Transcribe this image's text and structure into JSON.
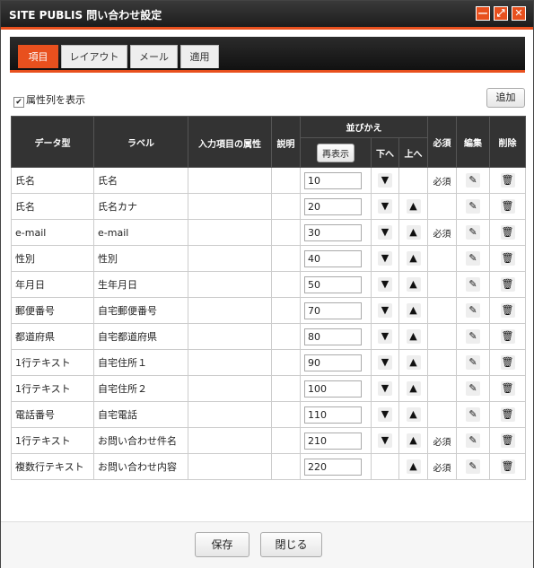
{
  "window": {
    "title": "SITE PUBLIS 問い合わせ設定",
    "minimize": "—",
    "maximize": "⤢",
    "close": "✕"
  },
  "tabs": [
    {
      "label": "項目",
      "active": true
    },
    {
      "label": "レイアウト",
      "active": false
    },
    {
      "label": "メール",
      "active": false
    },
    {
      "label": "適用",
      "active": false
    }
  ],
  "toolbar": {
    "show_attr_label": "属性列を表示",
    "show_attr_checked": true,
    "add_label": "追加"
  },
  "table": {
    "headers": {
      "type": "データ型",
      "label": "ラベル",
      "attr": "入力項目の属性",
      "desc": "説明",
      "sort": "並びかえ",
      "refresh": "再表示",
      "down": "下へ",
      "up": "上へ",
      "required": "必須",
      "edit": "編集",
      "delete": "削除"
    },
    "rows": [
      {
        "type": "氏名",
        "label": "氏名",
        "order": "10",
        "down": true,
        "up": false,
        "required": "必須"
      },
      {
        "type": "氏名",
        "label": "氏名カナ",
        "order": "20",
        "down": true,
        "up": true,
        "required": ""
      },
      {
        "type": "e-mail",
        "label": "e-mail",
        "order": "30",
        "down": true,
        "up": true,
        "required": "必須"
      },
      {
        "type": "性別",
        "label": "性別",
        "order": "40",
        "down": true,
        "up": true,
        "required": ""
      },
      {
        "type": "年月日",
        "label": "生年月日",
        "order": "50",
        "down": true,
        "up": true,
        "required": ""
      },
      {
        "type": "郵便番号",
        "label": "自宅郵便番号",
        "order": "70",
        "down": true,
        "up": true,
        "required": ""
      },
      {
        "type": "都道府県",
        "label": "自宅都道府県",
        "order": "80",
        "down": true,
        "up": true,
        "required": ""
      },
      {
        "type": "1行テキスト",
        "label": "自宅住所１",
        "order": "90",
        "down": true,
        "up": true,
        "required": ""
      },
      {
        "type": "1行テキスト",
        "label": "自宅住所２",
        "order": "100",
        "down": true,
        "up": true,
        "required": ""
      },
      {
        "type": "電話番号",
        "label": "自宅電話",
        "order": "110",
        "down": true,
        "up": true,
        "required": ""
      },
      {
        "type": "1行テキスト",
        "label": "お問い合わせ件名",
        "order": "210",
        "down": true,
        "up": true,
        "required": "必須"
      },
      {
        "type": "複数行テキスト",
        "label": "お問い合わせ内容",
        "order": "220",
        "down": false,
        "up": true,
        "required": "必須"
      }
    ]
  },
  "icons": {
    "down": "arrow-down-icon",
    "up": "arrow-up-icon",
    "edit": "pencil-icon",
    "delete": "trash-icon"
  },
  "footer": {
    "save": "保存",
    "close": "閉じる"
  },
  "colors": {
    "accent": "#e8501e",
    "header_bg": "#333333"
  }
}
